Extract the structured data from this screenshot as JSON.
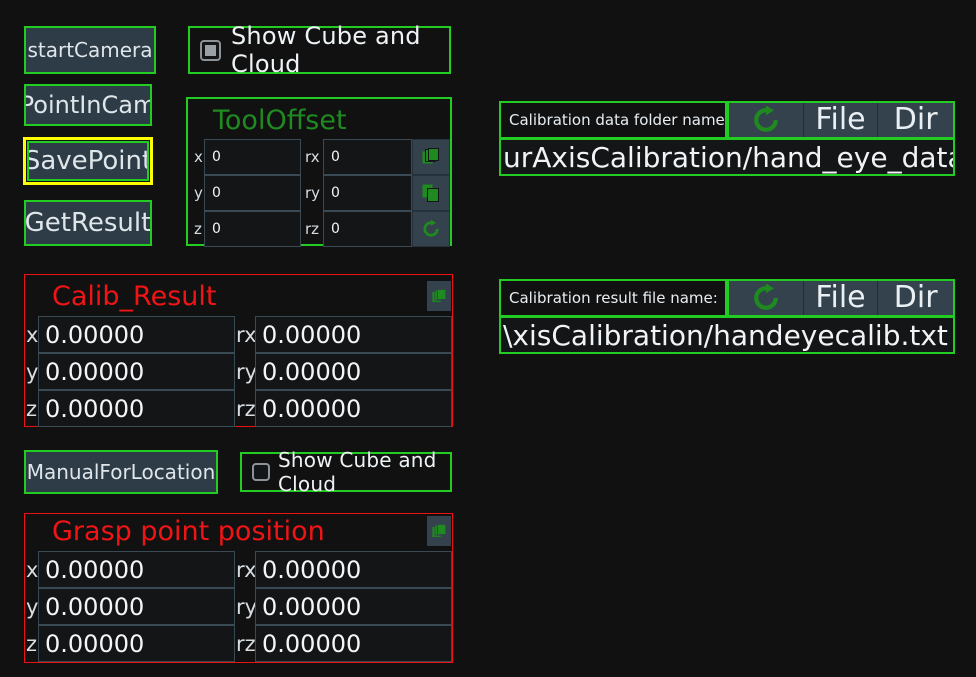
{
  "theme": {
    "background": "#111112",
    "accent_green": "#22cc22",
    "accent_red": "#ee1111",
    "focus_yellow": "#ffff00",
    "button_fill": "#2e3c47",
    "icon_button_fill": "#33424d",
    "icon_green": "#1f8a1f",
    "text": "#eef3f6"
  },
  "left_buttons": [
    {
      "label": "startCamera",
      "focused": false
    },
    {
      "label": "PointInCam",
      "focused": false
    },
    {
      "label": "SavePoint",
      "focused": true
    },
    {
      "label": "GetResult",
      "focused": false
    }
  ],
  "checkbox_top": {
    "label": "Show Cube and Cloud",
    "checked": true,
    "icon": "checkbox-checked-icon"
  },
  "checkbox_bottom": {
    "label": "Show Cube and Cloud",
    "checked": false,
    "icon": "checkbox-unchecked-icon"
  },
  "tool_offset": {
    "title": "ToolOffset",
    "labels": {
      "x": "x",
      "y": "y",
      "z": "z",
      "rx": "rx",
      "ry": "ry",
      "rz": "rz"
    },
    "values": {
      "x": "0",
      "y": "0",
      "z": "0",
      "rx": "0",
      "ry": "0",
      "rz": "0"
    },
    "icons": [
      "copy-icon",
      "paste-icon",
      "refresh-icon"
    ]
  },
  "calib_result": {
    "title": "Calib_Result",
    "labels": {
      "x": "x",
      "y": "y",
      "z": "z",
      "rx": "rx",
      "ry": "ry",
      "rz": "rz"
    },
    "values": {
      "x": "0.00000",
      "y": "0.00000",
      "z": "0.00000",
      "rx": "0.00000",
      "ry": "0.00000",
      "rz": "0.00000"
    },
    "icon": "copy-icon"
  },
  "manual_button": {
    "label": "ManualForLocation"
  },
  "grasp_point": {
    "title": "Grasp point position",
    "labels": {
      "x": "x",
      "y": "y",
      "z": "z",
      "rx": "rx",
      "ry": "ry",
      "rz": "rz"
    },
    "values": {
      "x": "0.00000",
      "y": "0.00000",
      "z": "0.00000",
      "rx": "0.00000",
      "ry": "0.00000",
      "rz": "0.00000"
    },
    "icon": "copy-icon"
  },
  "file_rows": [
    {
      "label": "Calibration data folder name:",
      "refresh_icon": "refresh-icon",
      "file_label": "File",
      "dir_label": "Dir",
      "path": "urAxisCalibration/hand_eye_data"
    },
    {
      "label": "Calibration result file name:",
      "refresh_icon": "refresh-icon",
      "file_label": "File",
      "dir_label": "Dir",
      "path": "\\xisCalibration/handeyecalib.txt"
    }
  ]
}
